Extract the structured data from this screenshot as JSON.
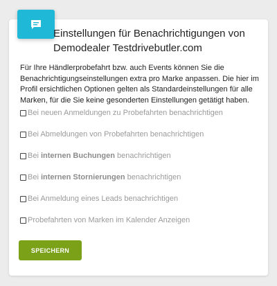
{
  "header": {
    "icon": "chat-message-icon",
    "title_line1": "Einstellungen für Benachrichtigungen von",
    "title_line2": "Demodealer Testdrivebutler.com"
  },
  "description": "Für Ihre Händlerprobefahrt bzw. auch Events können Sie die Benachrichtigungseinstellungen extra pro Marke anpassen. Die hier im Profil ersichtlichen Optionen gelten als Standardeinstellungen für alle Marken, für die Sie keine gesonderten Einstellungen getätigt haben.",
  "options": [
    {
      "before": "Bei neuen Anmeldungen zu Probefahrten benachrichtigen",
      "bold": "",
      "after": "",
      "checked": false
    },
    {
      "before": "Bei Abmeldungen von Probefahrten benachrichtigen",
      "bold": "",
      "after": "",
      "checked": false
    },
    {
      "before": "Bei ",
      "bold": "internen Buchungen",
      "after": " benachrichtigen",
      "checked": false
    },
    {
      "before": "Bei ",
      "bold": "internen Stornierungen",
      "after": " benachrichtigen",
      "checked": false
    },
    {
      "before": "Bei Anmeldung eines Leads benachrichtigen",
      "bold": "",
      "after": "",
      "checked": false
    },
    {
      "before": "Probefahrten von Marken im Kalender Anzeigen",
      "bold": "",
      "after": "",
      "checked": false
    }
  ],
  "save_label": "SPEICHERN",
  "colors": {
    "accent": "#1fb8d6",
    "button": "#7aa117",
    "muted_text": "#9a9a9a"
  }
}
